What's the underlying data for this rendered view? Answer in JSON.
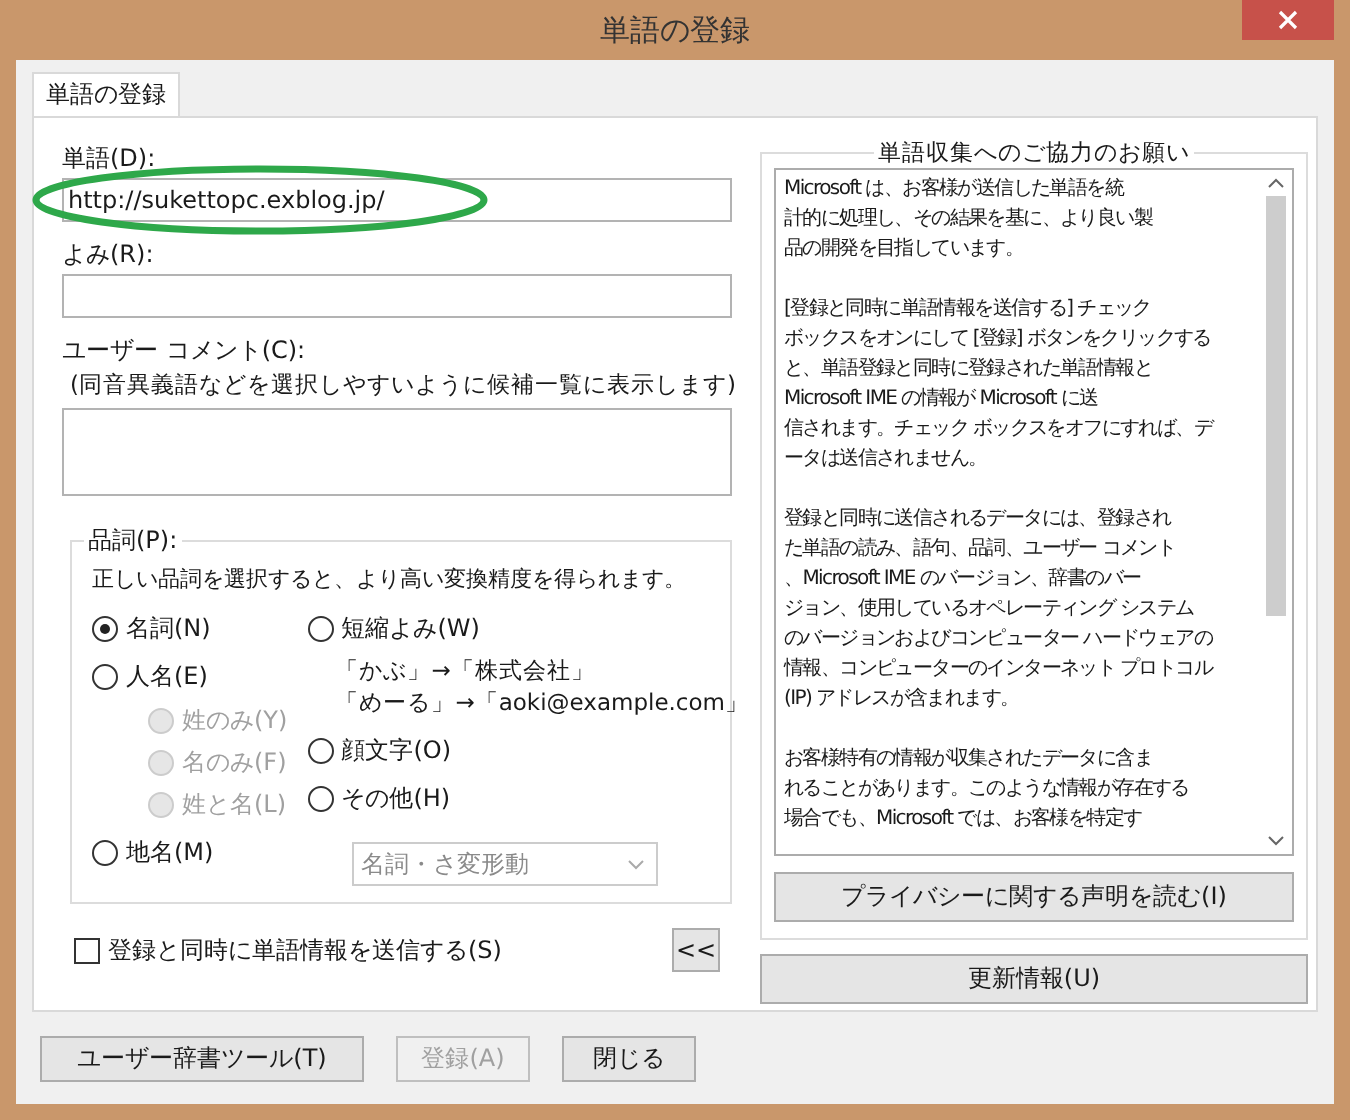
{
  "window": {
    "title": "単語の登録"
  },
  "tabs": [
    {
      "label": "単語の登録",
      "selected": true
    }
  ],
  "word": {
    "label": "単語(D):",
    "value": "http://sukettopc.exblog.jp/"
  },
  "reading": {
    "label": "よみ(R):"
  },
  "comment": {
    "label": "ユーザー コメント(C):",
    "hint": "(同音異義語などを選択しやすいように候補一覧に表示します)"
  },
  "part_of_speech": {
    "label": "品詞(P):",
    "description": "正しい品詞を選択すると、より高い変換精度を得られます。",
    "left_options": [
      {
        "label": "名詞(N)",
        "selected": true,
        "disabled": false
      },
      {
        "label": "人名(E)",
        "selected": false,
        "disabled": false,
        "children": [
          {
            "label": "姓のみ(Y)",
            "selected": false,
            "disabled": true
          },
          {
            "label": "名のみ(F)",
            "selected": false,
            "disabled": true
          },
          {
            "label": "姓と名(L)",
            "selected": false,
            "disabled": true
          }
        ]
      },
      {
        "label": "地名(M)",
        "selected": false,
        "disabled": false
      }
    ],
    "right_options": [
      {
        "label": "短縮よみ(W)",
        "selected": false,
        "disabled": false,
        "examples": [
          "「かぶ」→「株式会社」",
          "「めーる」→「aoki@example.com」"
        ]
      },
      {
        "label": "顔文字(O)",
        "selected": false,
        "disabled": false
      },
      {
        "label": "その他(H)",
        "selected": false,
        "disabled": false
      }
    ],
    "dropdown": {
      "value": "名詞・さ変形動",
      "disabled": true
    }
  },
  "send_checkbox": {
    "label": "登録と同時に単語情報を送信する(S)",
    "checked": false
  },
  "collapse_button": "<<",
  "info": {
    "title": "単語収集へのご協力のお願い",
    "paragraphs": [
      [
        "Microsoft は、お客様が送信した単語を統",
        "計的に処理し、その結果を基に、より良い製",
        "品の開発を目指しています。"
      ],
      [
        "[登録と同時に単語情報を送信する] チェック",
        "ボックスをオンにして [登録] ボタンをクリックする",
        "と、単語登録と同時に登録された単語情報と",
        "Microsoft IME の情報が Microsoft に送",
        "信されます。チェック ボックスをオフにすれば、デ",
        "ータは送信されません。"
      ],
      [
        "登録と同時に送信されるデータには、登録され",
        "た単語の読み、語句、品詞、ユーザー コメント",
        "、Microsoft IME のバージョン、辞書のバー",
        "ジョン、使用しているオペレーティング システム",
        "のバージョンおよびコンピューター ハードウェアの",
        "情報、コンピューターのインターネット プロトコル",
        "(IP) アドレスが含まれます。"
      ],
      [
        "お客様特有の情報が収集されたデータに含ま",
        "れることがあります。このような情報が存在する",
        "場合でも、Microsoft では、お客様を特定す"
      ]
    ],
    "privacy_button": "プライバシーに関する声明を読む(I)"
  },
  "update_button": "更新情報(U)",
  "buttons": [
    {
      "label": "ユーザー辞書ツール(T)",
      "disabled": false
    },
    {
      "label": "登録(A)",
      "disabled": true
    },
    {
      "label": "閉じる",
      "disabled": false
    }
  ]
}
